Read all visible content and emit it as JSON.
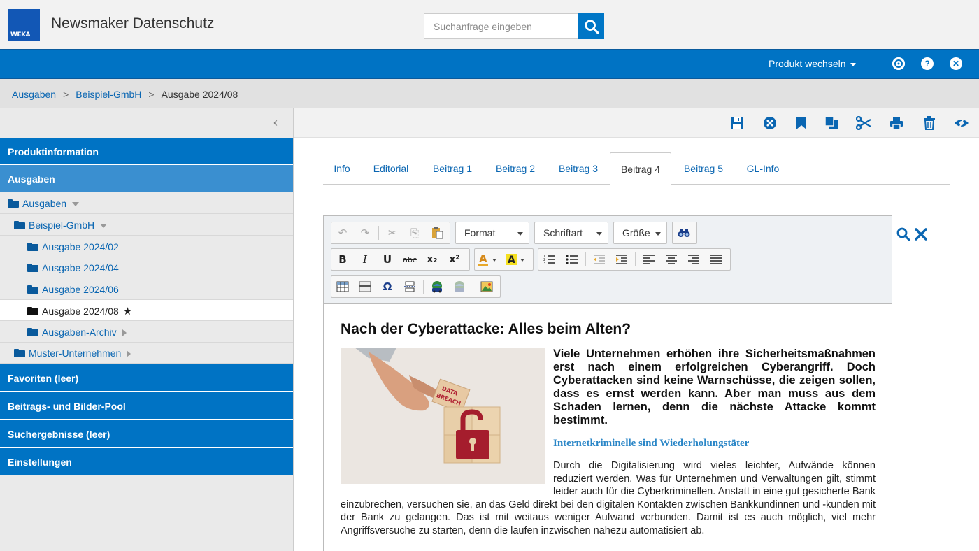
{
  "header": {
    "logo_text": "WEKA",
    "app_title": "Newsmaker Datenschutz",
    "search_placeholder": "Suchanfrage eingeben"
  },
  "topbar": {
    "product_switch": "Produkt wechseln",
    "icons": [
      "settings-icon",
      "help-icon",
      "close-icon"
    ]
  },
  "breadcrumb": {
    "items": [
      "Ausgaben",
      "Beispiel-GmbH"
    ],
    "current": "Ausgabe 2024/08",
    "separator": ">"
  },
  "sidebar": {
    "sections_top": [
      "Produktinformation",
      "Ausgaben"
    ],
    "tree": [
      {
        "label": "Ausgaben",
        "expander": "down"
      },
      {
        "label": "Beispiel-GmbH",
        "expander": "down"
      },
      {
        "label": "Ausgabe 2024/02"
      },
      {
        "label": "Ausgabe 2024/04"
      },
      {
        "label": "Ausgabe 2024/06"
      },
      {
        "label": "Ausgabe 2024/08",
        "selected": true,
        "favorite": "★"
      },
      {
        "label": "Ausgaben-Archiv",
        "expander": "right"
      },
      {
        "label": "Muster-Unternehmen",
        "expander": "right"
      }
    ],
    "sections_bottom": [
      "Favoriten (leer)",
      "Beitrags- und Bilder-Pool",
      "Suchergebnisse (leer)",
      "Einstellungen"
    ]
  },
  "main_toolbar": {
    "icons": [
      "save-icon",
      "cancel-icon",
      "bookmark-icon",
      "copy-icon",
      "cut-icon",
      "print-icon",
      "delete-icon",
      "preview-icon"
    ]
  },
  "tabs": [
    "Info",
    "Editorial",
    "Beitrag 1",
    "Beitrag 2",
    "Beitrag 3",
    "Beitrag 4",
    "Beitrag 5",
    "GL-Info"
  ],
  "active_tab": "Beitrag 4",
  "editor": {
    "format_label": "Format",
    "font_label": "Schriftart",
    "size_label": "Größe",
    "bold": "B",
    "italic": "I",
    "underline": "U",
    "strike": "abc",
    "sub": "x₂",
    "sup": "x²"
  },
  "article": {
    "title": "Nach der Cyberattacke: Alles beim Alten?",
    "image_label": "DATA BREACH",
    "lead": "Viele Unternehmen erhöhen ihre Sicherheitsmaßnahmen erst nach einem erfolgreichen Cyberangriff. Doch Cyberattacken sind keine Warnschüsse, die zeigen sollen, dass es ernst werden kann. Aber man muss aus dem Schaden lernen, denn die nächste Attacke kommt bestimmt.",
    "subheading": "Internetkriminelle sind Wiederholungstäter",
    "paragraph": "Durch die Digitalisierung wird vieles leichter, Aufwände können reduziert werden. Was für Unternehmen und Verwaltungen gilt, stimmt leider auch für die Cyberkriminellen. Anstatt in eine gut gesicherte Bank einzubrechen, versuchen sie, an das Geld direkt bei den digitalen Kontakten zwischen Bankkundinnen und -kunden mit der Bank zu gelangen. Das ist mit weitaus weniger Aufwand verbunden. Damit ist es auch möglich, viel mehr Angriffsversuche zu starten, denn die laufen inzwischen nahezu automatisiert ab."
  },
  "colors": {
    "brand_blue": "#0073c4",
    "active_section": "#3a8fd0",
    "link": "#0a66b2",
    "lock_red": "#a51d2d"
  }
}
